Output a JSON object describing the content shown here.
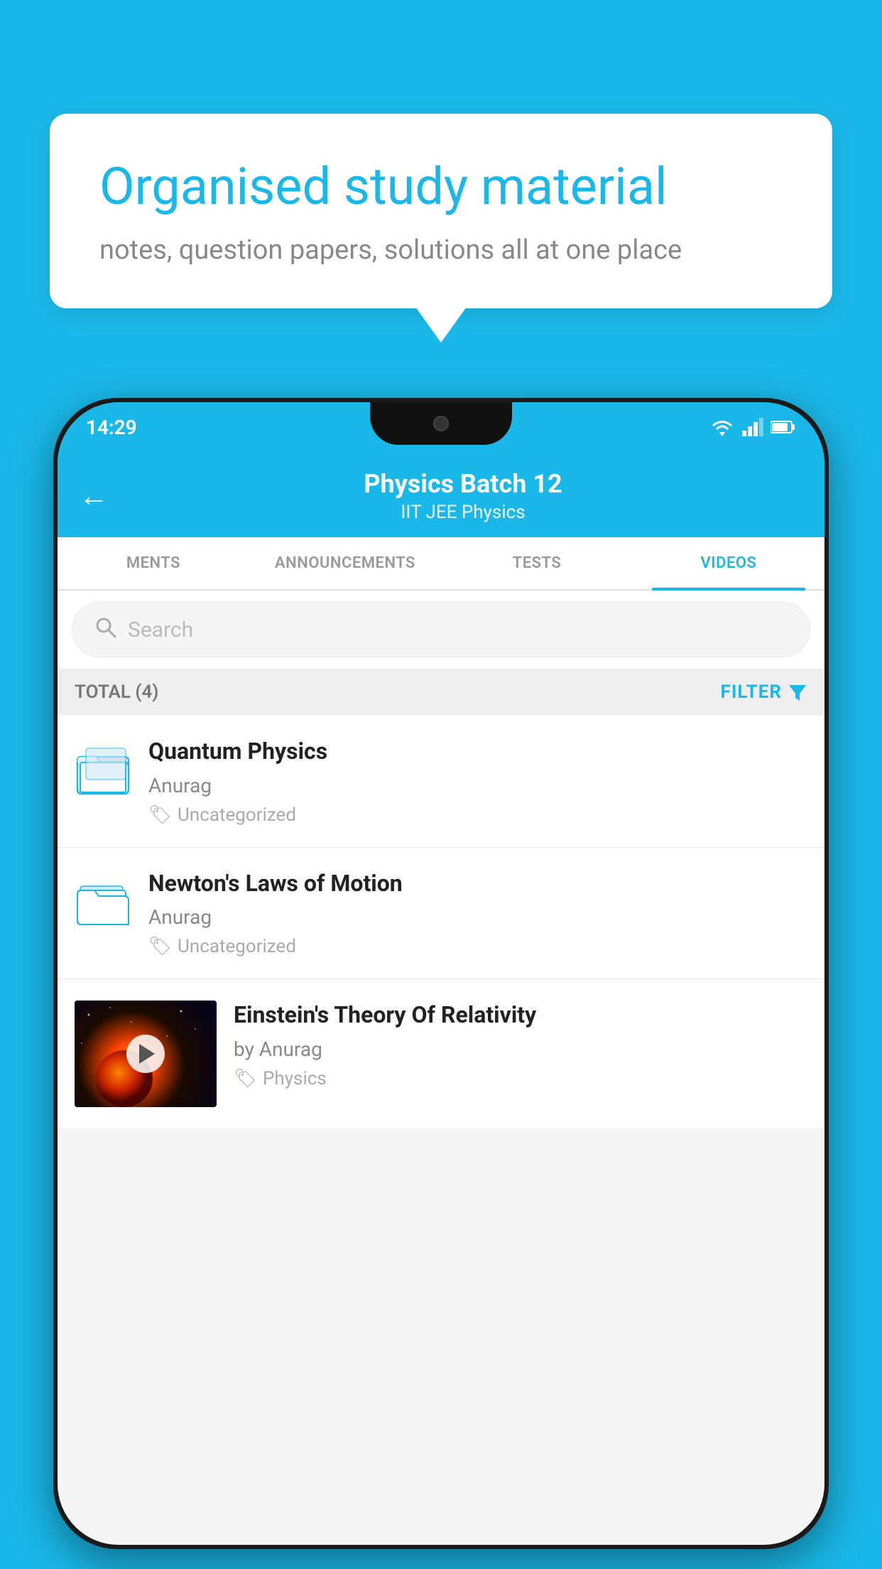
{
  "background_color": "#1ab8e8",
  "bubble": {
    "title": "Organised study material",
    "subtitle": "notes, question papers, solutions all at one place"
  },
  "phone": {
    "status_bar": {
      "time": "14:29"
    },
    "header": {
      "title": "Physics Batch 12",
      "subtitle_tags": "IIT JEE   Physics",
      "back_label": "←"
    },
    "tabs": [
      {
        "label": "MENTS",
        "active": false
      },
      {
        "label": "ANNOUNCEMENTS",
        "active": false
      },
      {
        "label": "TESTS",
        "active": false
      },
      {
        "label": "VIDEOS",
        "active": true
      }
    ],
    "search": {
      "placeholder": "Search"
    },
    "filter_bar": {
      "total": "TOTAL (4)",
      "filter_label": "FILTER"
    },
    "videos": [
      {
        "id": 1,
        "title": "Quantum Physics",
        "author": "Anurag",
        "tag": "Uncategorized",
        "type": "folder"
      },
      {
        "id": 2,
        "title": "Newton's Laws of Motion",
        "author": "Anurag",
        "tag": "Uncategorized",
        "type": "folder"
      },
      {
        "id": 3,
        "title": "Einstein's Theory Of Relativity",
        "author": "by Anurag",
        "tag": "Physics",
        "type": "video"
      }
    ]
  }
}
